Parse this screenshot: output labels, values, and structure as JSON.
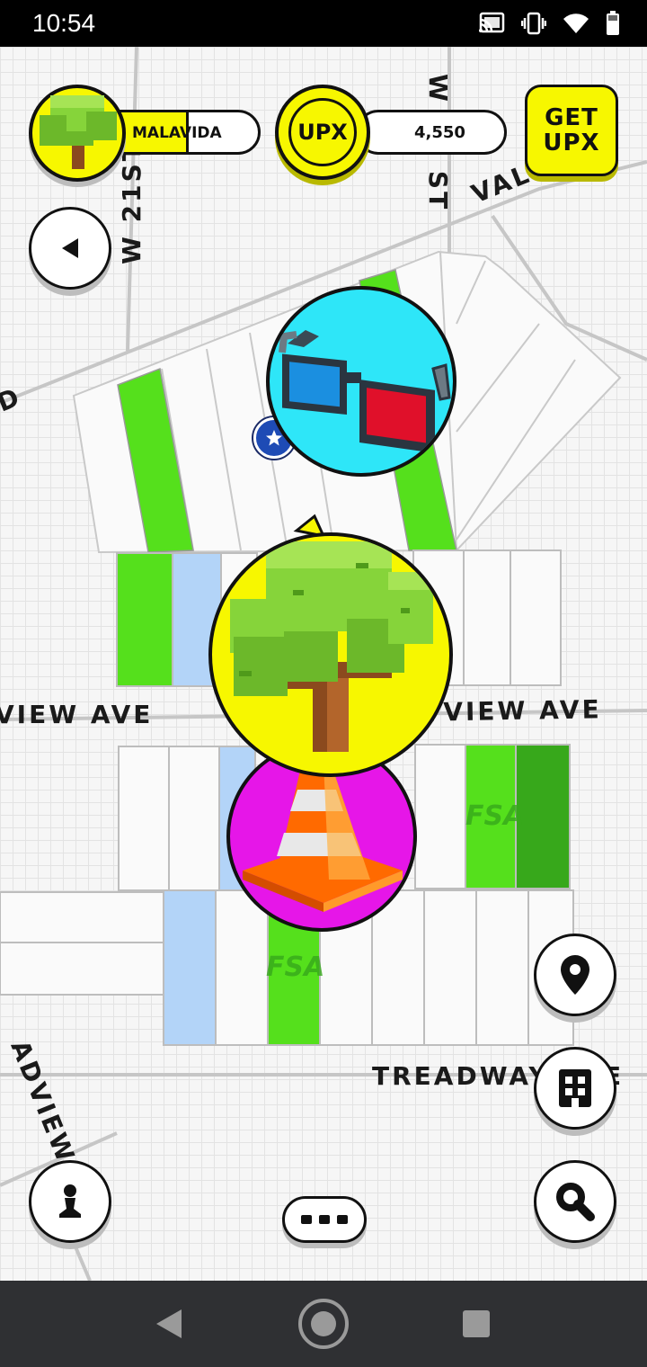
{
  "status_bar": {
    "time": "10:54",
    "icons": [
      "cast-icon",
      "vibrate-icon",
      "wifi-icon",
      "battery-icon"
    ]
  },
  "player": {
    "name": "MALAVIDA",
    "avatar_icon": "tree-icon"
  },
  "currency": {
    "badge": "UPX",
    "amount": "4,550"
  },
  "get_upx_button": {
    "line1": "GET",
    "line2": "UPX"
  },
  "streets": {
    "w21st": "W 21ST",
    "w_th_st": "W    TH ST",
    "valley": "VALLE",
    "left_ave": "VIEW AVE",
    "right_ave": "YVIEW AVE",
    "treadway": "TREADWAY",
    "treadway_suffix": "E",
    "adview": "ADVIEW",
    "edge_d": "D"
  },
  "property_labels": {
    "fsa_1": "FSA",
    "fsa_2": "FSA"
  },
  "map_markers": [
    {
      "name": "glasses-marker",
      "icon": "3d-glasses-icon",
      "color": "#2ee6f8"
    },
    {
      "name": "tree-marker",
      "icon": "tree-icon",
      "color": "#f7f700"
    },
    {
      "name": "cone-marker",
      "icon": "traffic-cone-icon",
      "color": "#e616e8"
    }
  ],
  "colors": {
    "owned_green": "#55e01c",
    "dark_green": "#37a81b",
    "light_blue": "#b3d4f8",
    "yellow": "#f7f700",
    "nav_bg": "#2f3033"
  },
  "controls": {
    "back": "back-arrow-icon",
    "location": "location-pin-icon",
    "buildings": "building-icon",
    "search": "magnifier-icon",
    "avatar": "pawn-icon",
    "more": "more-dots-icon"
  }
}
